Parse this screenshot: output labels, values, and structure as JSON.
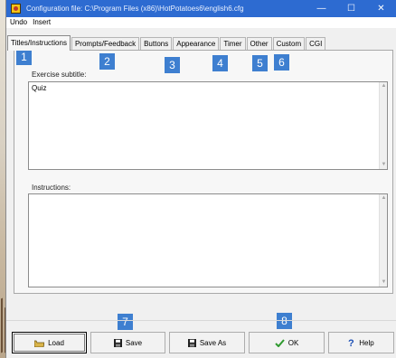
{
  "window": {
    "title": "Configuration file: C:\\Program Files (x86)\\HotPotatoes6\\english6.cfg",
    "minimize_glyph": "—",
    "maximize_glyph": "☐",
    "close_glyph": "✕"
  },
  "menu": [
    "Undo",
    "Insert"
  ],
  "tabs": [
    {
      "label": "Titles/Instructions",
      "active": true
    },
    {
      "label": "Prompts/Feedback",
      "active": false
    },
    {
      "label": "Buttons",
      "active": false
    },
    {
      "label": "Appearance",
      "active": false
    },
    {
      "label": "Timer",
      "active": false
    },
    {
      "label": "Other",
      "active": false
    },
    {
      "label": "Custom",
      "active": false
    },
    {
      "label": "CGI",
      "active": false
    }
  ],
  "fields": {
    "subtitle_label": "Exercise subtitle:",
    "subtitle_value": "Quiz",
    "instructions_label": "Instructions:",
    "instructions_value": ""
  },
  "buttons": {
    "load": "Load",
    "save": "Save",
    "save_as": "Save As",
    "ok": "OK",
    "help": "Help"
  },
  "badges": [
    "1",
    "2",
    "3",
    "4",
    "5",
    "6",
    "7",
    "8"
  ],
  "colors": {
    "titlebar": "#2d6bd1",
    "badge": "#3e7fd0",
    "ok_check": "#2e9a2e",
    "help_mark": "#1b4fb5"
  },
  "icons": [
    "app-icon",
    "load-icon",
    "save-icon",
    "save-as-icon",
    "checkmark-icon",
    "help-icon"
  ]
}
